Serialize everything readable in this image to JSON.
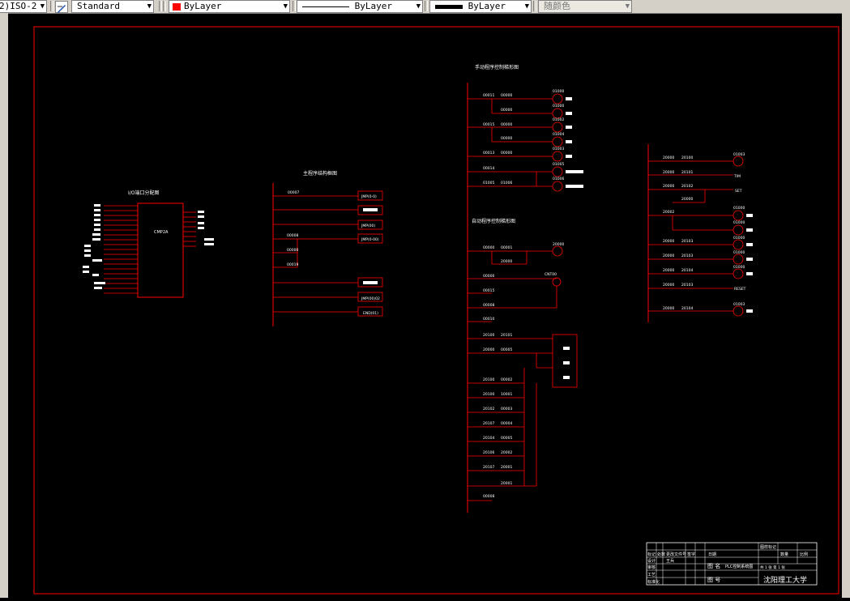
{
  "toolbar": {
    "dimstyle_value": "2)ISO-2",
    "textstyle_value": "Standard",
    "layer_color_label": "ByLayer",
    "linetype_label": "ByLayer",
    "lineweight_label": "ByLayer",
    "plotstyle_label": "随颜色",
    "colors": {
      "layer_red": "#ff0000"
    }
  },
  "drawing": {
    "io_title": "I/O端口分配图",
    "plc_label": "CMP2A",
    "main_title": "主程序结构框图",
    "main_blocks": [
      "JMP(0-0)",
      "",
      "JMP(00)",
      "JMP(0-00)",
      "",
      "JMP(00)02",
      "END(01)"
    ],
    "main_contacts": [
      "00007",
      "00008",
      "00000",
      "00019"
    ],
    "manual_title": "手动程序控制梯形图",
    "auto_title": "自动程序控制梯形图",
    "manual_contacts_left": [
      "00011",
      "00015",
      "00013",
      "00014",
      "01005"
    ],
    "manual_contacts_mid": [
      "00000",
      "00000",
      "00000",
      "00000",
      "00000",
      "01006"
    ],
    "manual_coils": [
      "01000",
      "01000",
      "01002",
      "01004",
      "01003",
      "01005",
      "01006"
    ],
    "auto_contacts_left": [
      "00000",
      "00006",
      "00015",
      "00008",
      "00010",
      "20100",
      "20000",
      "20100",
      "20100",
      "20102",
      "20107",
      "20104",
      "20106",
      "20107",
      "00008"
    ],
    "auto_contacts_mid": [
      "00001",
      "20000",
      "20101",
      "00005",
      "00002",
      "10001",
      "00003",
      "00004",
      "00005",
      "20002",
      "20001",
      "20001"
    ],
    "auto_coil": "20000",
    "auto_cnt": "CNT00",
    "right_contacts_left": [
      "20000",
      "20000",
      "20000",
      "20002",
      "20000",
      "20000",
      "20000",
      "20000",
      "20000"
    ],
    "right_contacts_mid": [
      "20100",
      "20101",
      "20102",
      "20000",
      "20103",
      "20103",
      "20104",
      "20103",
      "20104"
    ],
    "right_coils": [
      "01003",
      "TIM",
      "SET",
      "01000",
      "01000",
      "01000",
      "01000",
      "01000",
      "RESET",
      "01003"
    ],
    "title_block": {
      "header_cells": [
        "标记",
        "处数",
        "更改文件号",
        "签字",
        "日期",
        "图样标记",
        "数量",
        "比例"
      ],
      "left_rows": [
        "设计",
        "审核",
        "工艺",
        "标准化"
      ],
      "designer": "王兵",
      "drawing_name": "PLC控制系统图",
      "name_label": "图 名",
      "number_label": "图 号",
      "sheet_info": "共 1 张 第 1 张",
      "university": "沈阳理工大学"
    }
  }
}
